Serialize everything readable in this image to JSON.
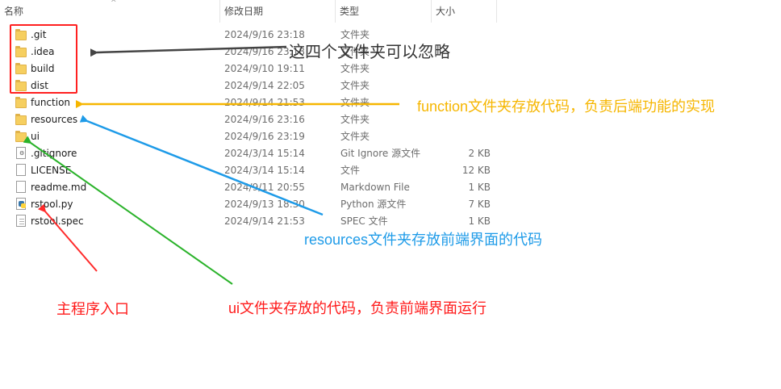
{
  "header": {
    "name": "名称",
    "modified": "修改日期",
    "type": "类型",
    "size": "大小",
    "sort_glyph": "^"
  },
  "files": [
    {
      "name": ".git",
      "modified": "2024/9/16 23:18",
      "type": "文件夹",
      "size": "",
      "icon": "folder-icon"
    },
    {
      "name": ".idea",
      "modified": "2024/9/16 23:18",
      "type": "文件夹",
      "size": "",
      "icon": "folder-icon"
    },
    {
      "name": "build",
      "modified": "2024/9/10 19:11",
      "type": "文件夹",
      "size": "",
      "icon": "folder-icon"
    },
    {
      "name": "dist",
      "modified": "2024/9/14 22:05",
      "type": "文件夹",
      "size": "",
      "icon": "folder-icon"
    },
    {
      "name": "function",
      "modified": "2024/9/14 21:53",
      "type": "文件夹",
      "size": "",
      "icon": "folder-icon"
    },
    {
      "name": "resources",
      "modified": "2024/9/16 23:16",
      "type": "文件夹",
      "size": "",
      "icon": "folder-icon"
    },
    {
      "name": "ui",
      "modified": "2024/9/16 23:19",
      "type": "文件夹",
      "size": "",
      "icon": "folder-icon"
    },
    {
      "name": ".gitignore",
      "modified": "2024/3/14 15:14",
      "type": "Git Ignore 源文件",
      "size": "2 KB",
      "icon": "settings-file-icon"
    },
    {
      "name": "LICENSE",
      "modified": "2024/3/14 15:14",
      "type": "文件",
      "size": "12 KB",
      "icon": "blank-file-icon"
    },
    {
      "name": "readme.md",
      "modified": "2024/9/11 20:55",
      "type": "Markdown File",
      "size": "1 KB",
      "icon": "blank-file-icon"
    },
    {
      "name": "rstool.py",
      "modified": "2024/9/13 18:30",
      "type": "Python 源文件",
      "size": "7 KB",
      "icon": "python-file-icon"
    },
    {
      "name": "rstool.spec",
      "modified": "2024/9/14 21:53",
      "type": "SPEC 文件",
      "size": "1 KB",
      "icon": "text-file-icon"
    }
  ],
  "annotations": {
    "ignore": {
      "text": "这四个文件夹可以忽略",
      "color": "#333333"
    },
    "function": {
      "text": "function文件夹存放代码，负责后端功能的实现",
      "color": "#f6b600"
    },
    "resources": {
      "text": "resources文件夹存放前端界面的代码",
      "color": "#1e9be8"
    },
    "ui": {
      "text": "ui文件夹存放的代码，负责前端界面运行",
      "color": "#ff1a1a"
    },
    "main": {
      "text": "主程序入口",
      "color": "#ff1a1a"
    }
  },
  "colors": {
    "folder": "#f6cf60",
    "redbox": "#ff2020",
    "arrow_gray": "#444444",
    "arrow_yellow": "#f6b600",
    "arrow_blue": "#1e9be8",
    "arrow_green": "#2bb32b",
    "arrow_red": "#ff2a2a"
  }
}
